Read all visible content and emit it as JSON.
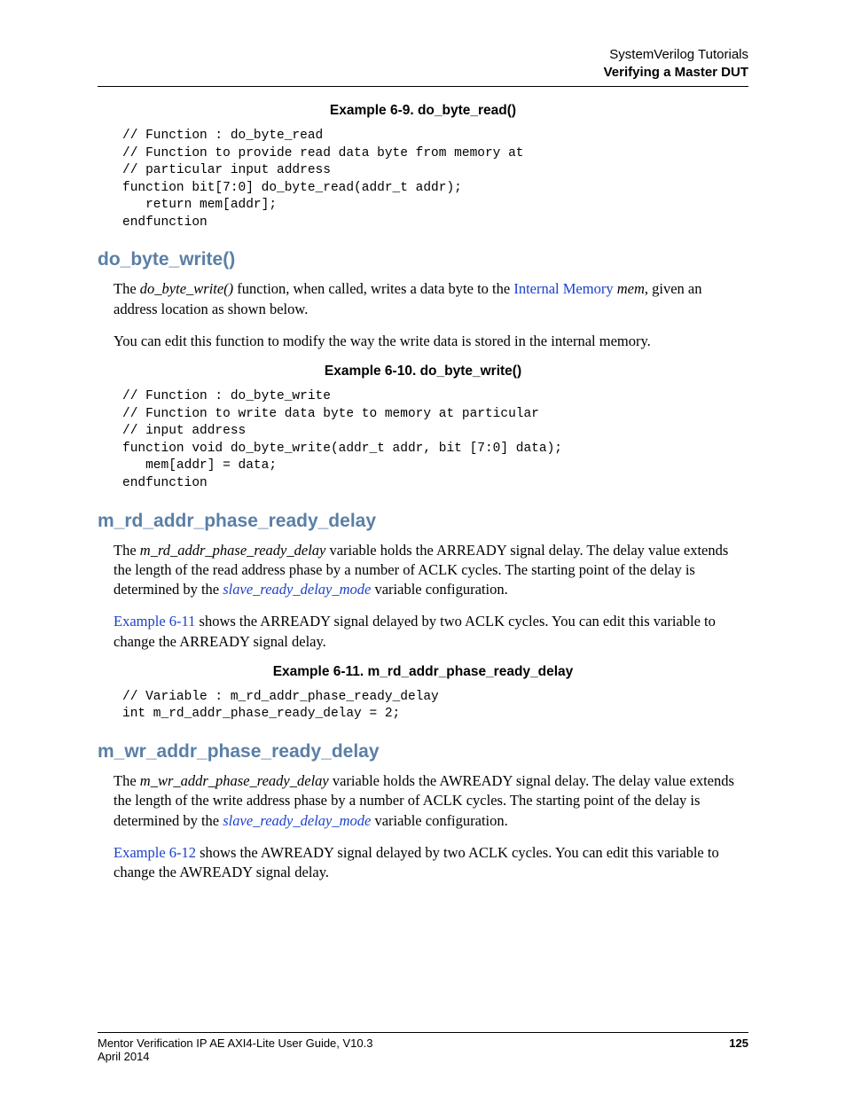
{
  "header": {
    "line1": "SystemVerilog Tutorials",
    "line2": "Verifying a Master DUT"
  },
  "ex69_title": "Example 6-9. do_byte_read()",
  "code69": "// Function : do_byte_read\n// Function to provide read data byte from memory at\n// particular input address\nfunction bit[7:0] do_byte_read(addr_t addr);\n   return mem[addr];\nendfunction",
  "sec1_heading": "do_byte_write()",
  "sec1_p1_a": "The ",
  "sec1_p1_fn": "do_byte_write()",
  "sec1_p1_b": " function, when called, writes a data byte to the ",
  "sec1_p1_link": "Internal Memory",
  "sec1_p1_c": " ",
  "sec1_p1_mem": "mem",
  "sec1_p1_d": ", given an address location as shown below.",
  "sec1_p2": "You can edit this function to modify the way the write data is stored in the internal memory.",
  "ex610_title": "Example 6-10. do_byte_write()",
  "code610": "// Function : do_byte_write\n// Function to write data byte to memory at particular\n// input address\nfunction void do_byte_write(addr_t addr, bit [7:0] data);\n   mem[addr] = data;\nendfunction",
  "sec2_heading": "m_rd_addr_phase_ready_delay",
  "sec2_p1_a": "The ",
  "sec2_p1_var": "m_rd_addr_phase_ready_delay",
  "sec2_p1_b": " variable holds the ARREADY signal delay. The delay value extends the length of the read address phase by a number of ACLK cycles. The starting point of the delay is determined by the ",
  "sec2_p1_link": "slave_ready_delay_mode",
  "sec2_p1_c": " variable configuration.",
  "sec2_p2_link": "Example 6-11",
  "sec2_p2_b": " shows the ARREADY signal delayed by two ACLK cycles. You can edit this variable to change the ARREADY signal delay.",
  "ex611_title": "Example 6-11. m_rd_addr_phase_ready_delay",
  "code611": "// Variable : m_rd_addr_phase_ready_delay\nint m_rd_addr_phase_ready_delay = 2;",
  "sec3_heading": "m_wr_addr_phase_ready_delay",
  "sec3_p1_a": "The ",
  "sec3_p1_var": "m_wr_addr_phase_ready_delay",
  "sec3_p1_b": " variable holds the AWREADY signal delay. The delay value extends the length of the write address phase by a number of ACLK cycles. The starting point of the delay is determined by the ",
  "sec3_p1_link": "slave_ready_delay_mode",
  "sec3_p1_c": " variable configuration.",
  "sec3_p2_link": "Example 6-12",
  "sec3_p2_b": " shows the AWREADY signal delayed by two ACLK cycles. You can edit this variable to change the AWREADY signal delay.",
  "footer": {
    "left1": "Mentor Verification IP AE AXI4-Lite User Guide, V10.3",
    "left2": "April 2014",
    "page": "125"
  }
}
